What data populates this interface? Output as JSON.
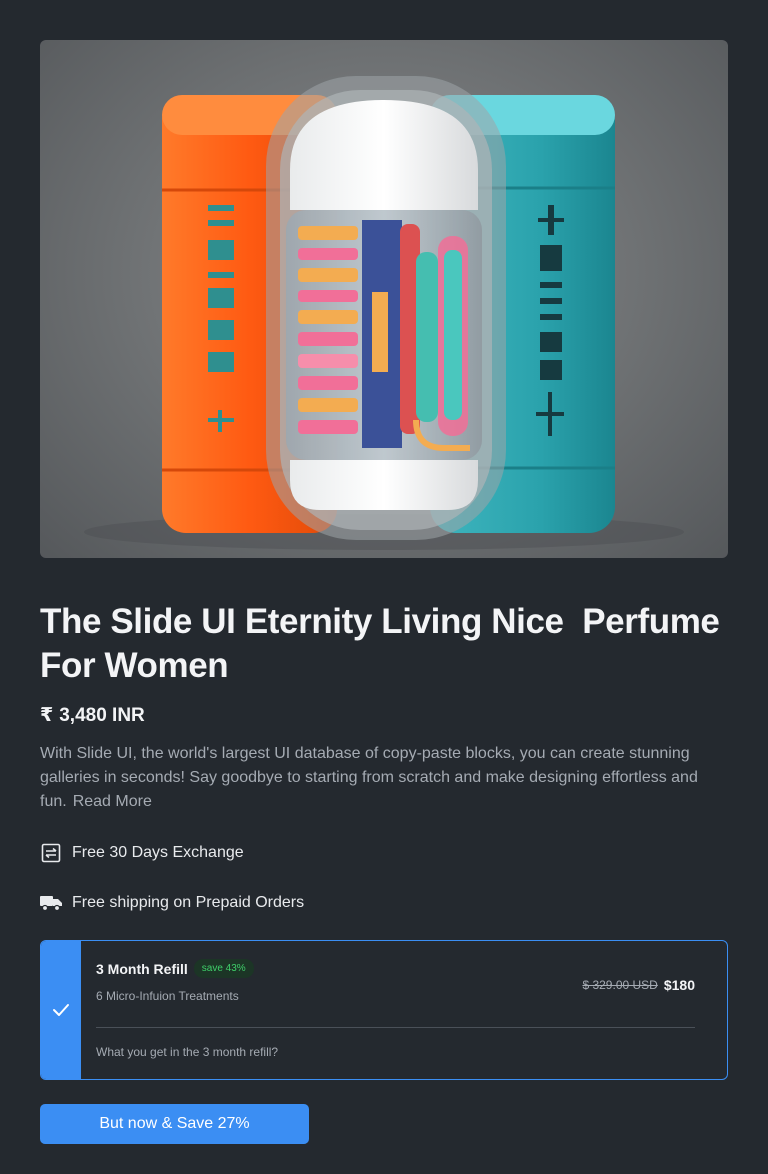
{
  "product": {
    "image_alt": "Three colorful perfume capsules",
    "title": "The Slide UI Eternity Living Nice  Perfume For Women",
    "currency_symbol": "₹",
    "price": "3,480 INR",
    "description": "With Slide UI, the world's largest UI database of copy-paste blocks, you can create stunning galleries in seconds! Say goodbye to starting from scratch and make designing effortless and fun.",
    "read_more": "Read More"
  },
  "features": [
    {
      "icon": "exchange-icon",
      "label": "Free 30 Days Exchange"
    },
    {
      "icon": "truck-icon",
      "label": "Free shipping on Prepaid Orders"
    }
  ],
  "plan": {
    "name": "3 Month Refill",
    "badge": "save 43%",
    "subtitle": "6 Micro-Infuion Treatments",
    "old_price": "$ 329.00 USD",
    "new_price": "$180",
    "footer": "What you get in the 3 month refill?",
    "selected": true
  },
  "cta": {
    "label": "But now & Save 27%"
  },
  "colors": {
    "background": "#24292f",
    "accent": "#3b8ef3",
    "badge_text": "#3fcf6a"
  }
}
